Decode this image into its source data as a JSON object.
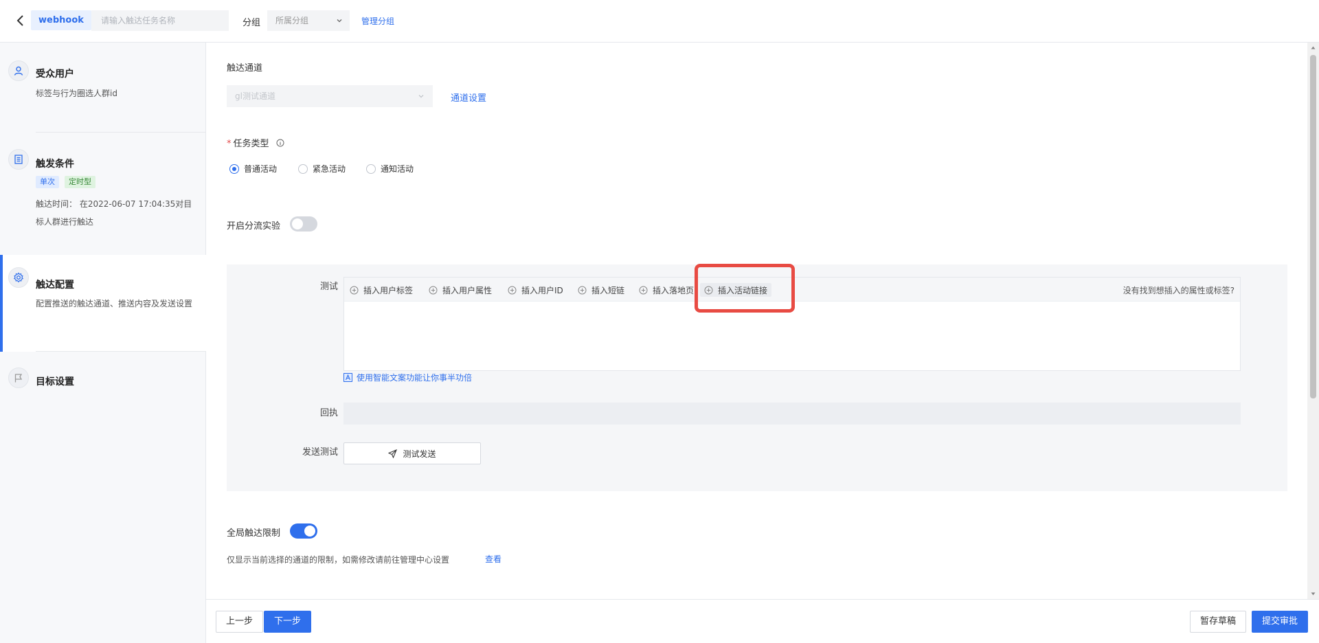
{
  "header": {
    "channel_tag": "webhook",
    "task_name_placeholder": "请输入触达任务名称",
    "group_label": "分组",
    "group_select": "所属分组",
    "manage_group": "管理分组"
  },
  "sidebar": {
    "steps": [
      {
        "title": "受众用户",
        "desc": "标签与行为圈选人群id"
      },
      {
        "title": "触发条件",
        "badges": [
          "单次",
          "定时型"
        ],
        "desc": "触达时间： 在2022-06-07 17:04:35对目标人群进行触达"
      },
      {
        "title": "触达配置",
        "desc": "配置推送的触达通道、推送内容及发送设置"
      },
      {
        "title": "目标设置"
      }
    ]
  },
  "main": {
    "channel_label": "触达通道",
    "channel_select": "gl测试通道",
    "channel_settings": "通道设置",
    "task_type_label": "任务类型",
    "task_types": [
      {
        "label": "普通活动",
        "checked": true
      },
      {
        "label": "紧急活动",
        "checked": false
      },
      {
        "label": "通知活动",
        "checked": false
      }
    ],
    "ab_test_label": "开启分流实验",
    "ab_test_enabled": false,
    "test_label": "测试",
    "toolbar": [
      "插入用户标签",
      "插入用户属性",
      "插入用户ID",
      "插入短链",
      "插入落地页",
      "插入活动链接"
    ],
    "toolbar_help": "没有找到想插入的属性或标签?",
    "ai_hint": "使用智能文案功能让你事半功倍",
    "receipt_label": "回执",
    "send_test_label": "发送测试",
    "send_test_button": "测试发送",
    "global_limit_label": "全局触达限制",
    "global_limit_enabled": true,
    "global_limit_note": "仅显示当前选择的通道的限制，如需修改请前往管理中心设置",
    "view_link": "查看"
  },
  "footer": {
    "prev": "上一步",
    "next": "下一步",
    "save_draft": "暂存草稿",
    "submit": "提交审批"
  },
  "colors": {
    "primary": "#2f6fec",
    "highlight": "#e84b43"
  }
}
